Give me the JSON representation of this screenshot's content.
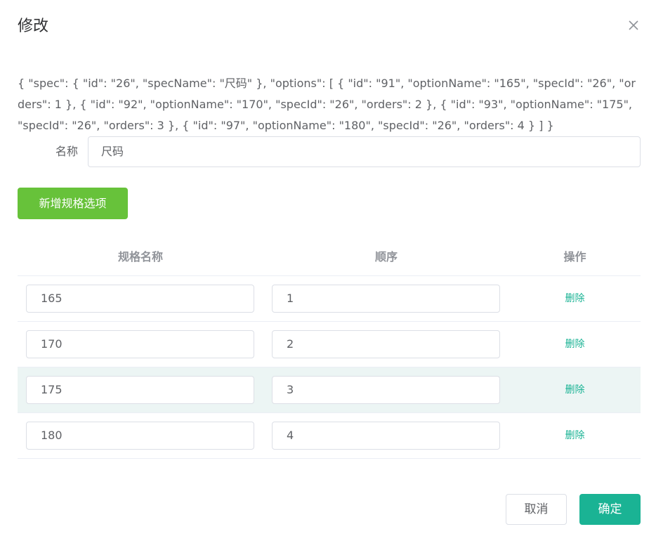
{
  "dialog": {
    "title": "修改",
    "close_icon": "close-icon"
  },
  "json_text": "{ \"spec\": { \"id\": \"26\", \"specName\": \"尺码\" }, \"options\": [ { \"id\": \"91\", \"optionName\": \"165\", \"specId\": \"26\", \"orders\": 1 }, { \"id\": \"92\", \"optionName\": \"170\", \"specId\": \"26\", \"orders\": 2 }, { \"id\": \"93\", \"optionName\": \"175\", \"specId\": \"26\", \"orders\": 3 }, { \"id\": \"97\", \"optionName\": \"180\", \"specId\": \"26\", \"orders\": 4 } ] }",
  "form": {
    "name_label": "名称",
    "name_value": "尺码"
  },
  "add_button": "新增规格选项",
  "table": {
    "headers": [
      "规格名称",
      "顺序",
      "操作"
    ],
    "rows": [
      {
        "name": "165",
        "order": "1",
        "action": "删除"
      },
      {
        "name": "170",
        "order": "2",
        "action": "删除"
      },
      {
        "name": "175",
        "order": "3",
        "action": "删除"
      },
      {
        "name": "180",
        "order": "4",
        "action": "删除"
      }
    ],
    "hover_row": 2
  },
  "footer": {
    "cancel": "取消",
    "confirm": "确定"
  },
  "colors": {
    "primary": "#1ab394",
    "success": "#67c23a",
    "row_hover": "#ecf5f4"
  }
}
